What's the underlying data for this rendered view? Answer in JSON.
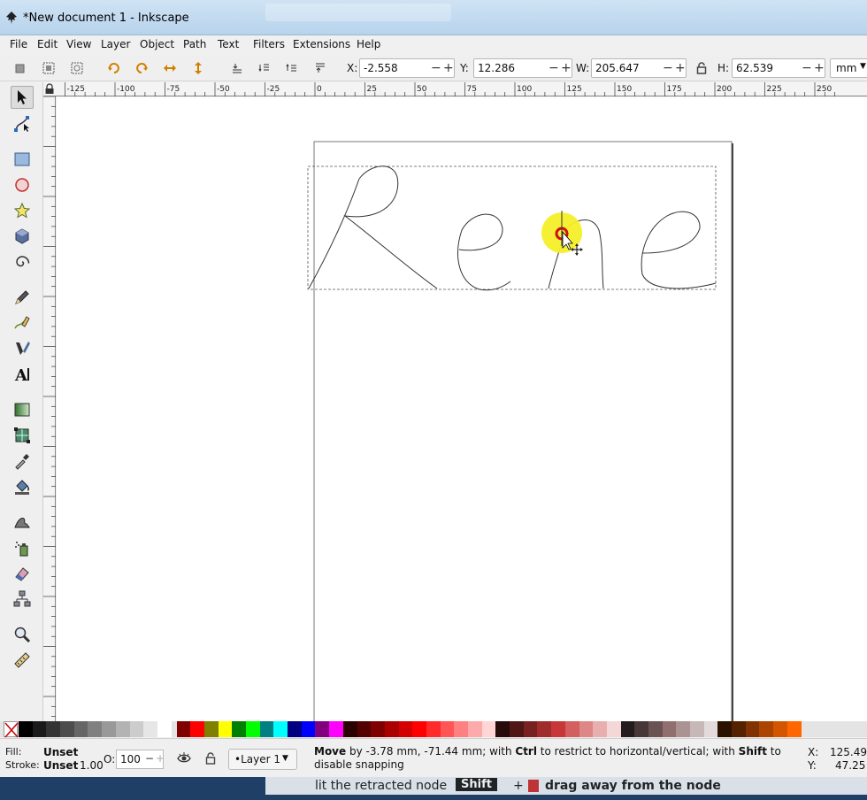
{
  "window": {
    "title": "*New document 1 - Inkscape"
  },
  "menu": [
    "File",
    "Edit",
    "View",
    "Layer",
    "Object",
    "Path",
    "Text",
    "Filters",
    "Extensions",
    "Help"
  ],
  "toolbar": {
    "x_label": "X:",
    "x_value": "-2.558",
    "y_label": "Y:",
    "y_value": "12.286",
    "w_label": "W:",
    "w_value": "205.647",
    "h_label": "H:",
    "h_value": "62.539",
    "minus": "−",
    "plus": "+",
    "unit": "mm"
  },
  "ruler_top": [
    "-125",
    "-100",
    "-75",
    "-50",
    "-25",
    "0",
    "25",
    "50",
    "75",
    "100",
    "125",
    "150",
    "175",
    "200",
    "225",
    "250"
  ],
  "canvas": {
    "drawing_text": "Rene"
  },
  "palette": [
    "#000000",
    "#1a1a1a",
    "#333333",
    "#4d4d4d",
    "#666666",
    "#808080",
    "#999999",
    "#b3b3b3",
    "#cccccc",
    "#e6e6e6",
    "#ffffff",
    "#800000",
    "#ff0000",
    "#808000",
    "#ffff00",
    "#008000",
    "#00ff00",
    "#008080",
    "#00ffff",
    "#000080",
    "#0000ff",
    "#800080",
    "#ff00ff",
    "#2b0000",
    "#550000",
    "#800000",
    "#aa0000",
    "#d40000",
    "#ff0000",
    "#ff2a2a",
    "#ff5555",
    "#ff8080",
    "#ffaaaa",
    "#ffd5d5",
    "#280b0b",
    "#501616",
    "#782121",
    "#a02c2c",
    "#c83737",
    "#d35f5f",
    "#de8787",
    "#e9afaf",
    "#f4d7d7",
    "#241c1c",
    "#483737",
    "#6c5353",
    "#916f6f",
    "#ac9393",
    "#c8b7b7",
    "#e3dbdb",
    "#2b1100",
    "#552200",
    "#803300",
    "#aa4400",
    "#d45500",
    "#ff6600"
  ],
  "status": {
    "fill_label": "Fill:",
    "fill_value": "Unset",
    "stroke_label": "Stroke:",
    "stroke_value": "Unset",
    "stroke_width": "1.00",
    "opacity_label": "O:",
    "opacity_value": "100",
    "layer": "•Layer 1",
    "message_bold1": "Move",
    "message_1": " by -3.78 mm, -71.44 mm; with ",
    "message_bold2": "Ctrl",
    "message_2": " to restrict to horizontal/vertical; with ",
    "message_bold3": "Shift",
    "message_3": " to disable snapping",
    "cursor_x_label": "X:",
    "cursor_x": "125.49",
    "cursor_y_label": "Y:",
    "cursor_y": "47.25"
  },
  "tip": {
    "text1": "lit the retracted node",
    "key": "Shift",
    "op": "+",
    "text2": "drag away from the node"
  }
}
